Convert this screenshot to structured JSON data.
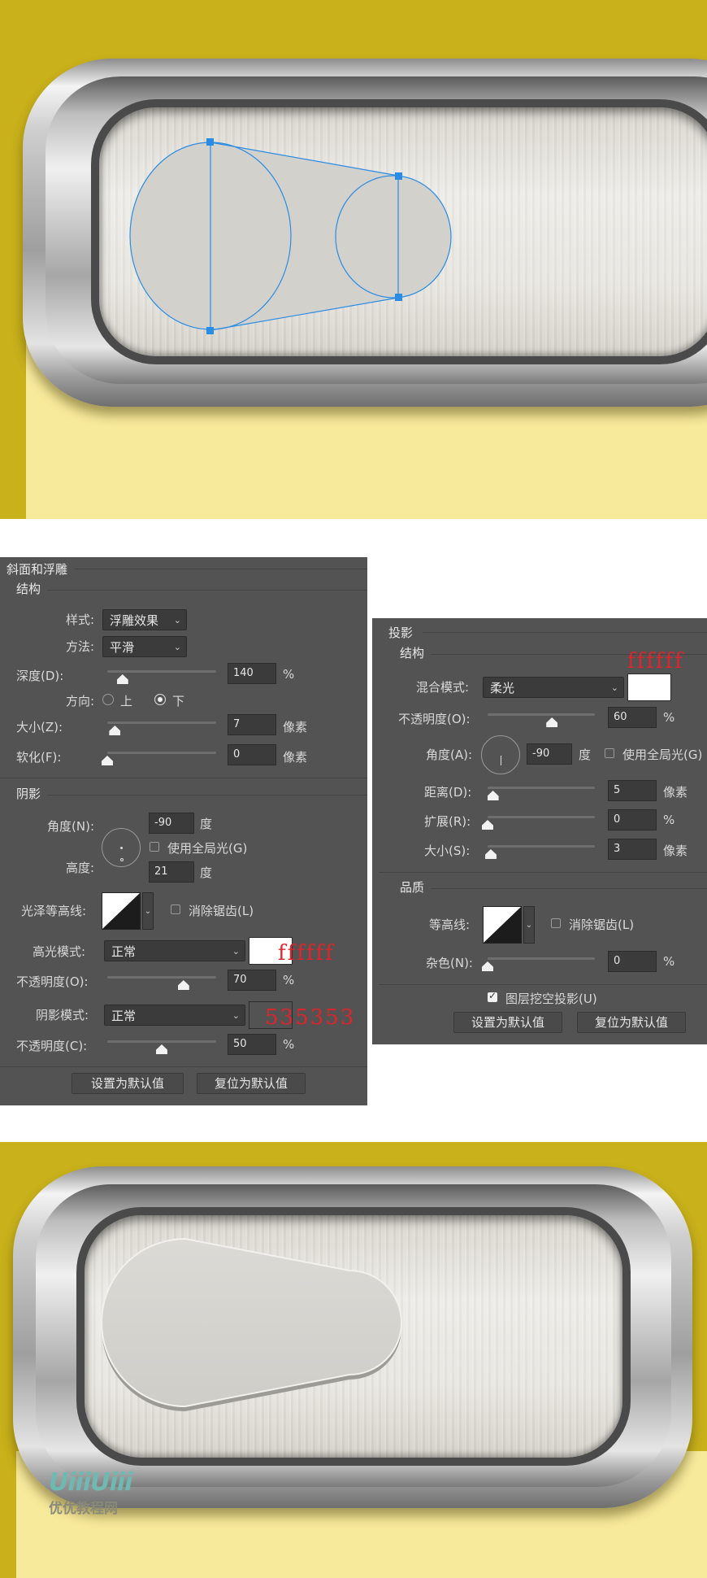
{
  "bevel_panel": {
    "title": "斜面和浮雕",
    "structure_header": "结构",
    "style_label": "样式:",
    "style_value": "浮雕效果",
    "technique_label": "方法:",
    "technique_value": "平滑",
    "depth_label": "深度(D):",
    "depth_value": "140",
    "depth_unit": "%",
    "direction_label": "方向:",
    "direction_up": "上",
    "direction_down": "下",
    "direction_selected": "下",
    "size_label": "大小(Z):",
    "size_value": "7",
    "size_unit": "像素",
    "soften_label": "软化(F):",
    "soften_value": "0",
    "soften_unit": "像素",
    "shading_header": "阴影",
    "angle_label": "角度(N):",
    "angle_value": "-90",
    "angle_unit": "度",
    "global_light_label": "使用全局光(G)",
    "altitude_label": "高度:",
    "altitude_value": "21",
    "altitude_unit": "度",
    "gloss_contour_label": "光泽等高线:",
    "anti_alias_label": "消除锯齿(L)",
    "highlight_mode_label": "高光模式:",
    "highlight_mode_value": "正常",
    "highlight_opacity_label": "不透明度(O):",
    "highlight_opacity_value": "70",
    "highlight_opacity_unit": "%",
    "shadow_mode_label": "阴影模式:",
    "shadow_mode_value": "正常",
    "shadow_opacity_label": "不透明度(C):",
    "shadow_opacity_value": "50",
    "shadow_opacity_unit": "%",
    "make_default_button": "设置为默认值",
    "reset_default_button": "复位为默认值",
    "highlight_color": "#ffffff",
    "shadow_color": "#535353",
    "highlight_note": "ffffff",
    "shadow_note": "535353",
    "depth_slider": 0.14,
    "size_slider": 0.07,
    "soften_slider": 0.0,
    "highlight_opacity_slider": 0.7,
    "shadow_opacity_slider": 0.5
  },
  "shadow_panel": {
    "title": "投影",
    "structure_header": "结构",
    "blend_mode_label": "混合模式:",
    "blend_mode_value": "柔光",
    "color_note": "ffffff",
    "shadow_color": "#ffffff",
    "opacity_label": "不透明度(O):",
    "opacity_value": "60",
    "opacity_unit": "%",
    "angle_label": "角度(A):",
    "angle_value": "-90",
    "angle_unit": "度",
    "global_light_label": "使用全局光(G)",
    "distance_label": "距离(D):",
    "distance_value": "5",
    "distance_unit": "像素",
    "spread_label": "扩展(R):",
    "spread_value": "0",
    "spread_unit": "%",
    "size_label": "大小(S):",
    "size_value": "3",
    "size_unit": "像素",
    "quality_header": "品质",
    "contour_label": "等高线:",
    "anti_alias_label": "消除锯齿(L)",
    "noise_label": "杂色(N):",
    "noise_value": "0",
    "noise_unit": "%",
    "knockout_label": "图层挖空投影(U)",
    "make_default_button": "设置为默认值",
    "reset_default_button": "复位为默认值",
    "opacity_slider": 0.6,
    "distance_slider": 0.05,
    "spread_slider": 0.0,
    "size_slider": 0.03,
    "noise_slider": 0.0
  },
  "watermark": {
    "logo": "UiiiUiii",
    "caption": "优优教程网"
  },
  "colors": {
    "background_gold": "#c9b11b",
    "background_pale": "#f8ea9b",
    "path_blue": "#2b8ce6",
    "annotation_red": "#e0242b"
  }
}
